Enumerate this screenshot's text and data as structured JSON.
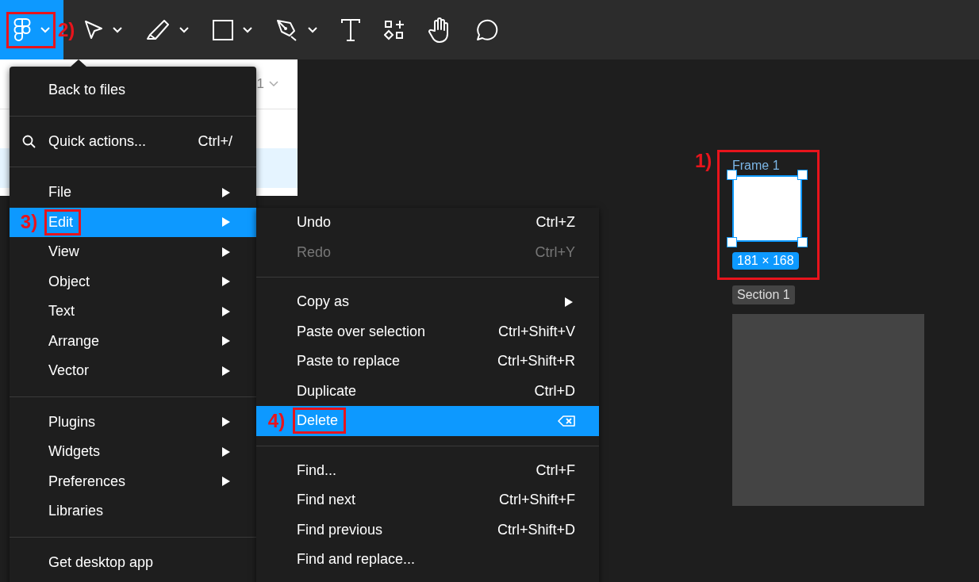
{
  "toolbar": {
    "logo_button": {
      "selected": true,
      "annotation": "2)"
    },
    "tools": [
      {
        "kind": "move",
        "dropdown": true
      },
      {
        "kind": "pencil",
        "dropdown": true
      },
      {
        "kind": "rectangle",
        "dropdown": true
      },
      {
        "kind": "pen",
        "dropdown": true
      },
      {
        "kind": "text",
        "dropdown": false
      },
      {
        "kind": "components",
        "dropdown": false
      },
      {
        "kind": "hand",
        "dropdown": false
      },
      {
        "kind": "comment",
        "dropdown": false
      }
    ]
  },
  "pages_panel": {
    "page_label": "1"
  },
  "main_menu": {
    "sections": [
      [
        {
          "kind": "command",
          "label": "Back to files",
          "selected": false
        }
      ],
      [
        {
          "kind": "search",
          "label": "Quick actions...",
          "shortcut": "Ctrl+/",
          "selected": false
        }
      ],
      [
        {
          "kind": "submenu",
          "label": "File",
          "selected": false
        },
        {
          "kind": "submenu",
          "label": "Edit",
          "selected": true,
          "annotation": "3)"
        },
        {
          "kind": "submenu",
          "label": "View",
          "selected": false
        },
        {
          "kind": "submenu",
          "label": "Object",
          "selected": false
        },
        {
          "kind": "submenu",
          "label": "Text",
          "selected": false
        },
        {
          "kind": "submenu",
          "label": "Arrange",
          "selected": false
        },
        {
          "kind": "submenu",
          "label": "Vector",
          "selected": false
        }
      ],
      [
        {
          "kind": "submenu",
          "label": "Plugins",
          "selected": false
        },
        {
          "kind": "submenu",
          "label": "Widgets",
          "selected": false
        },
        {
          "kind": "submenu",
          "label": "Preferences",
          "selected": false
        },
        {
          "kind": "command",
          "label": "Libraries",
          "selected": false
        }
      ],
      [
        {
          "kind": "command",
          "label": "Get desktop app",
          "selected": false
        }
      ]
    ]
  },
  "edit_menu": {
    "sections": [
      [
        {
          "kind": "command",
          "label": "Undo",
          "shortcut": "Ctrl+Z",
          "disabled": false,
          "selected": false
        },
        {
          "kind": "command",
          "label": "Redo",
          "shortcut": "Ctrl+Y",
          "disabled": true,
          "selected": false
        }
      ],
      [
        {
          "kind": "submenu",
          "label": "Copy as",
          "disabled": false,
          "selected": false
        },
        {
          "kind": "command",
          "label": "Paste over selection",
          "shortcut": "Ctrl+Shift+V",
          "disabled": false,
          "selected": false
        },
        {
          "kind": "command",
          "label": "Paste to replace",
          "shortcut": "Ctrl+Shift+R",
          "disabled": false,
          "selected": false
        },
        {
          "kind": "command",
          "label": "Duplicate",
          "shortcut": "Ctrl+D",
          "disabled": false,
          "selected": false
        },
        {
          "kind": "delete",
          "label": "Delete",
          "disabled": false,
          "selected": true,
          "annotation": "4)"
        }
      ],
      [
        {
          "kind": "command",
          "label": "Find...",
          "shortcut": "Ctrl+F",
          "disabled": false,
          "selected": false
        },
        {
          "kind": "command",
          "label": "Find next",
          "shortcut": "Ctrl+Shift+F",
          "disabled": false,
          "selected": false
        },
        {
          "kind": "command",
          "label": "Find previous",
          "shortcut": "Ctrl+Shift+D",
          "disabled": false,
          "selected": false
        },
        {
          "kind": "command",
          "label": "Find and replace...",
          "disabled": false,
          "selected": false
        }
      ]
    ]
  },
  "canvas": {
    "frame": {
      "name": "Frame 1",
      "size": "181 × 168",
      "selected": true,
      "annotation": "1)"
    },
    "section": {
      "name": "Section 1"
    }
  }
}
